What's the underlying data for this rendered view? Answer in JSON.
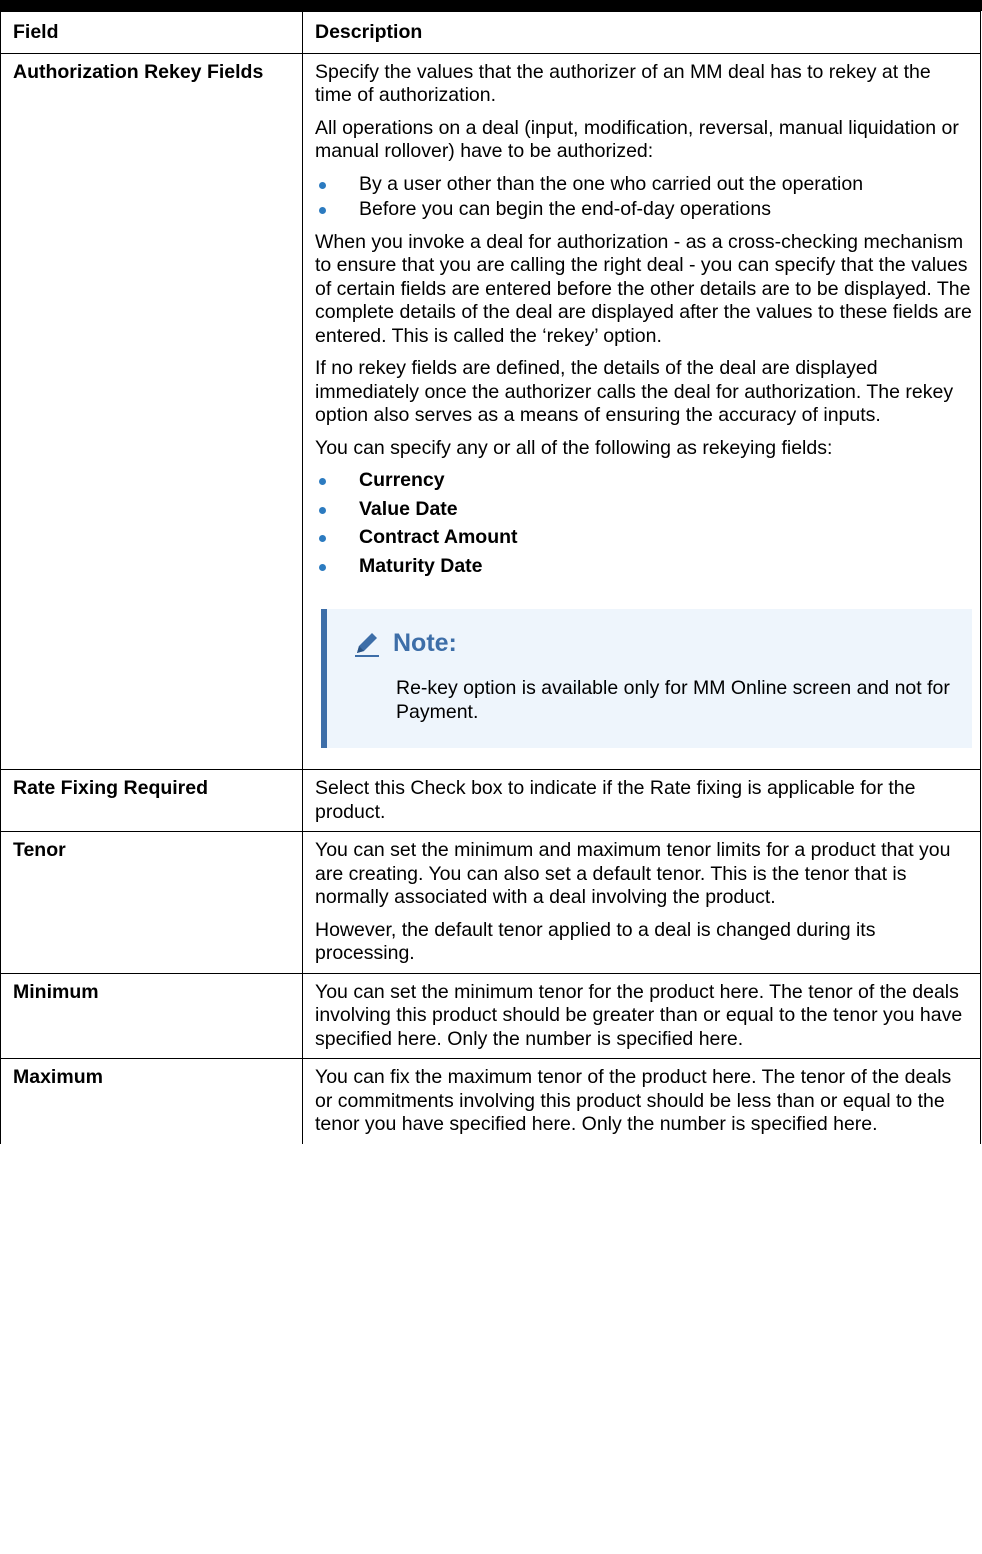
{
  "header": {
    "field": "Field",
    "description": "Description"
  },
  "rows": [
    {
      "field": "Authorization Rekey Fields",
      "p1": "Specify the values that the authorizer of an MM deal has to rekey at the time of authorization.",
      "p2": "All operations on a deal (input, modification, reversal, manual liquidation or manual rollover) have to be authorized:",
      "list1": [
        "By a user other than the one who carried out the operation",
        "Before you can begin the end-of-day operations"
      ],
      "p3": "When you invoke a deal for authorization - as a cross-checking mechanism to ensure that you are calling the right deal - you can specify that the values of certain fields are entered before the other details are to be displayed. The complete details of the deal are displayed after the values to these fields are entered. This is called the ‘rekey’ option.",
      "p4": "If no rekey fields are defined, the details of the deal are displayed immediately once the authorizer calls the deal for authorization. The rekey option also serves as a means of ensuring the accuracy of inputs.",
      "p5": "You can specify any or all of the following as rekeying fields:",
      "list2": [
        "Currency",
        "Value Date",
        "Contract Amount",
        "Maturity Date"
      ],
      "note_title": "Note:",
      "note_text": "Re-key option is available only for MM Online screen and not for Payment."
    },
    {
      "field": "Rate Fixing Required",
      "p1": "Select this Check box to indicate if the Rate fixing is applicable for the product."
    },
    {
      "field": "Tenor",
      "p1": "You can set the minimum and maximum tenor limits for a product that you are creating. You can also set a default tenor. This is the tenor that is normally associated with a deal involving the product.",
      "p2": "However, the default tenor applied to a deal is changed during its processing."
    },
    {
      "field": "Minimum",
      "p1": "You can set the minimum tenor for the product here. The tenor of the deals involving this product should be greater than or equal to the tenor you have specified here. Only the number is specified here."
    },
    {
      "field": "Maximum",
      "p1": "You can fix the maximum tenor of the product here. The tenor of the deals or commitments involving this product should be less than or equal to the tenor you have specified here. Only the number is specified here."
    }
  ],
  "colors": {
    "bullet": "#2c7bc0",
    "note_accent": "#3d6ea8",
    "note_bg": "#eef5fc"
  },
  "icons": {
    "note": "pencil-icon",
    "bullet": "bullet-dot"
  }
}
